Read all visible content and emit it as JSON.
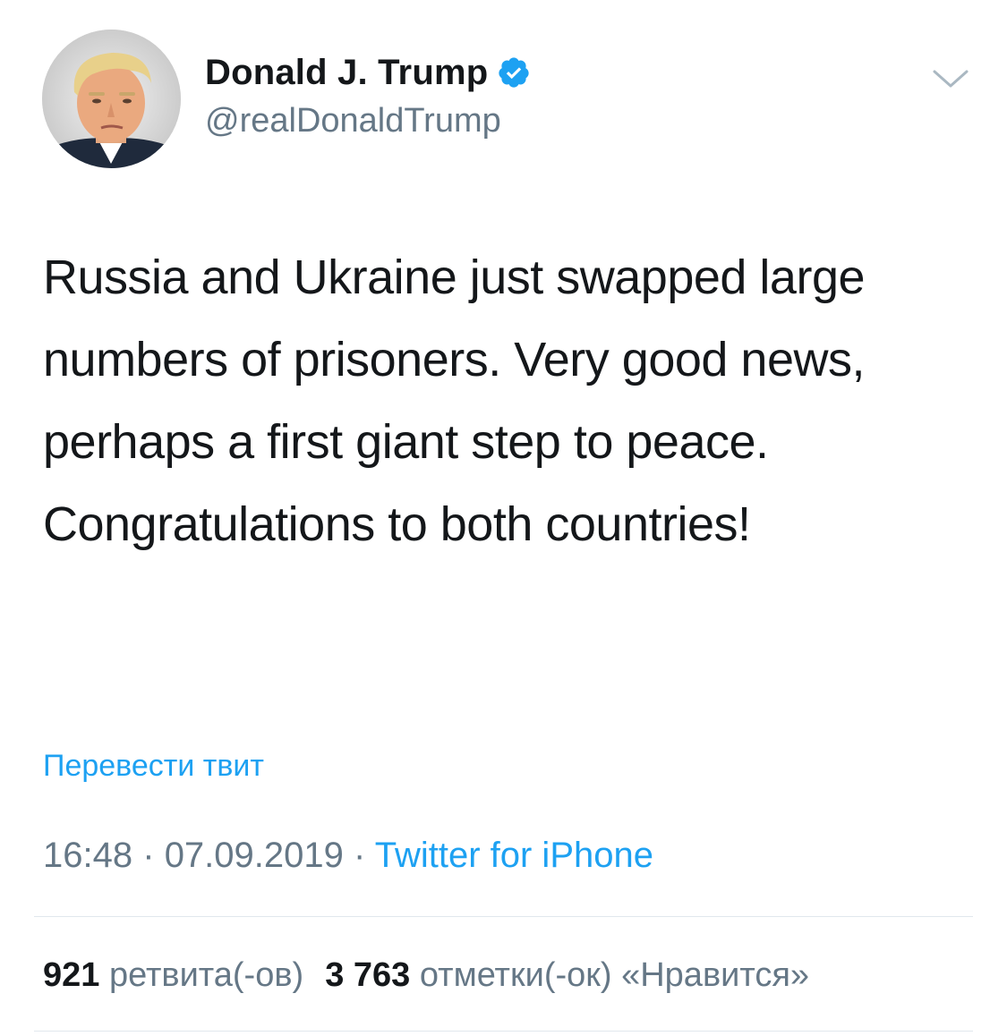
{
  "author": {
    "display_name": "Donald J. Trump",
    "handle": "@realDonaldTrump",
    "verified": true
  },
  "tweet": {
    "text": "Russia and Ukraine just swapped large numbers of prisoners. Very good news, perhaps a first giant step to peace. Congratulations to both countries!",
    "translate_label": "Перевести твит",
    "time": "16:48",
    "date": "07.09.2019",
    "separator": "·",
    "source": "Twitter for iPhone"
  },
  "stats": {
    "retweets_count": "921",
    "retweets_label": "ретвита(-ов)",
    "likes_count": "3 763",
    "likes_label": "отметки(-ок) «Нравится»"
  },
  "colors": {
    "accent": "#1da1f2",
    "text": "#14171a",
    "secondary": "#657786",
    "divider": "#e1e8ed"
  },
  "icons": {
    "verified": "verified-badge-icon",
    "menu": "chevron-down-icon"
  }
}
